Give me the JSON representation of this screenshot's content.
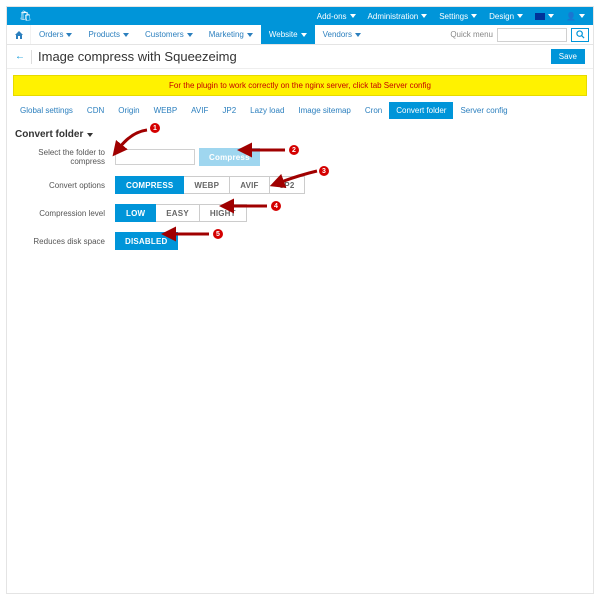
{
  "topbar": {
    "addons": "Add-ons",
    "administration": "Administration",
    "settings": "Settings",
    "design": "Design"
  },
  "menu": {
    "orders": "Orders",
    "products": "Products",
    "customers": "Customers",
    "marketing": "Marketing",
    "website": "Website",
    "vendors": "Vendors",
    "quickmenu": "Quick menu"
  },
  "page": {
    "title": "Image compress with Squeezeimg",
    "save": "Save"
  },
  "alert": "For the plugin to work correctly on the nginx server, click tab Server config",
  "tabs": {
    "global": "Global settings",
    "cdn": "CDN",
    "origin": "Origin",
    "webp": "WEBP",
    "avif": "AVIF",
    "jp2": "JP2",
    "lazy": "Lazy load",
    "sitemap": "Image sitemap",
    "cron": "Cron",
    "convert": "Convert folder",
    "server": "Server config"
  },
  "section": {
    "title": "Convert folder"
  },
  "form": {
    "select_label": "Select the folder to compress",
    "compress_btn": "Compress",
    "options_label": "Convert options",
    "opt_compress": "COMPRESS",
    "opt_webp": "WEBP",
    "opt_avif": "AVIF",
    "opt_jp2": "JP2",
    "level_label": "Compression level",
    "lvl_low": "LOW",
    "lvl_easy": "EASY",
    "lvl_high": "HIGHT",
    "space_label": "Reduces disk space",
    "disabled": "DISABLED"
  },
  "badges": {
    "b1": "1",
    "b2": "2",
    "b3": "3",
    "b4": "4",
    "b5": "5"
  }
}
